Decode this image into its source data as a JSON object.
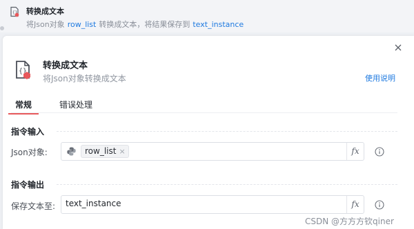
{
  "step": {
    "title": "转换成文本",
    "desc_prefix": "将Json对象",
    "input_var": "row_list",
    "desc_middle": "转换成文本，将结果保存到",
    "output_var": "text_instance"
  },
  "panel": {
    "title": "转换成文本",
    "description": "将Json对象转换成文本",
    "help_link": "使用说明",
    "tabs": [
      "常规",
      "错误处理"
    ],
    "input_section": {
      "title": "指令输入",
      "field_label": "Json对象:",
      "value_chip": "row_list",
      "fx": "fx"
    },
    "output_section": {
      "title": "指令输出",
      "field_label": "保存文本至:",
      "value": "text_instance",
      "fx": "fx"
    }
  },
  "watermark": "CSDN @方方方钦qiner",
  "colors": {
    "accent_blue": "#1f7ae0",
    "tab_underline": "#e8585b",
    "badge_red": "#e8585b"
  }
}
